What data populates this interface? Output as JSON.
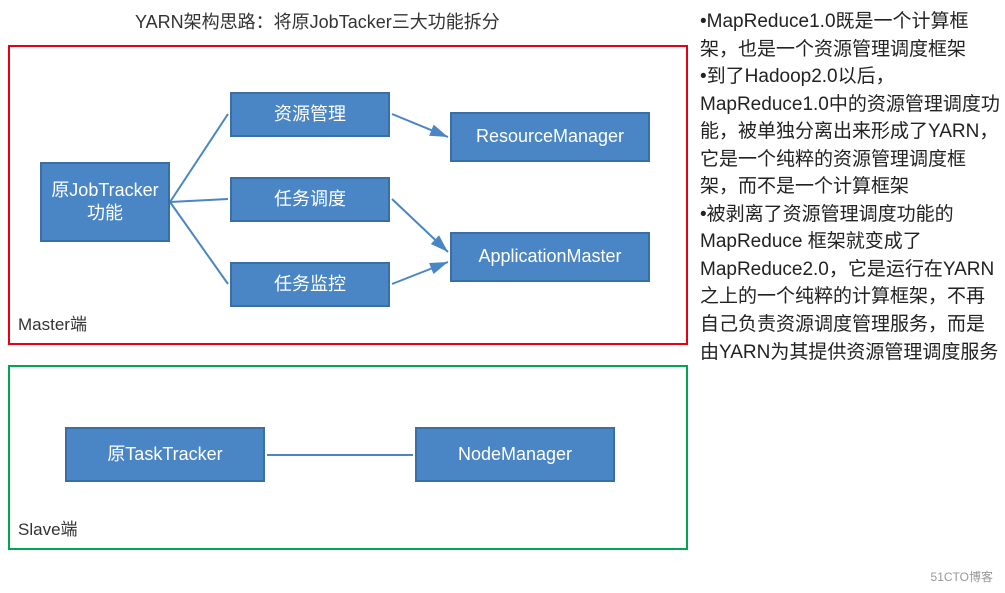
{
  "title": "YARN架构思路：将原JobTacker三大功能拆分",
  "masterLabel": "Master端",
  "slaveLabel": "Slave端",
  "nodes": {
    "jobTracker": "原JobTracker\n功能",
    "resMgmt": "资源管理",
    "taskSched": "任务调度",
    "taskMon": "任务监控",
    "resourceManager": "ResourceManager",
    "applicationMaster": "ApplicationMaster",
    "taskTracker": "原TaskTracker",
    "nodeManager": "NodeManager"
  },
  "sideText": {
    "p1": "•MapReduce1.0既是一个计算框架，也是一个资源管理调度框架",
    "p2": "•到了Hadoop2.0以后，MapReduce1.0中的资源管理调度功能，被单独分离出来形成了YARN，它是一个纯粹的资源管理调度框架，而不是一个计算框架",
    "p3": "•被剥离了资源管理调度功能的MapReduce 框架就变成了MapReduce2.0，它是运行在YARN之上的一个纯粹的计算框架，不再自己负责资源调度管理服务，而是由YARN为其提供资源管理调度服务"
  },
  "watermark": "51CTO博客",
  "colors": {
    "nodeFill": "#4a86c5",
    "nodeBorder": "#3a6fa5",
    "redBorder": "#e60012",
    "greenBorder": "#00a651"
  }
}
